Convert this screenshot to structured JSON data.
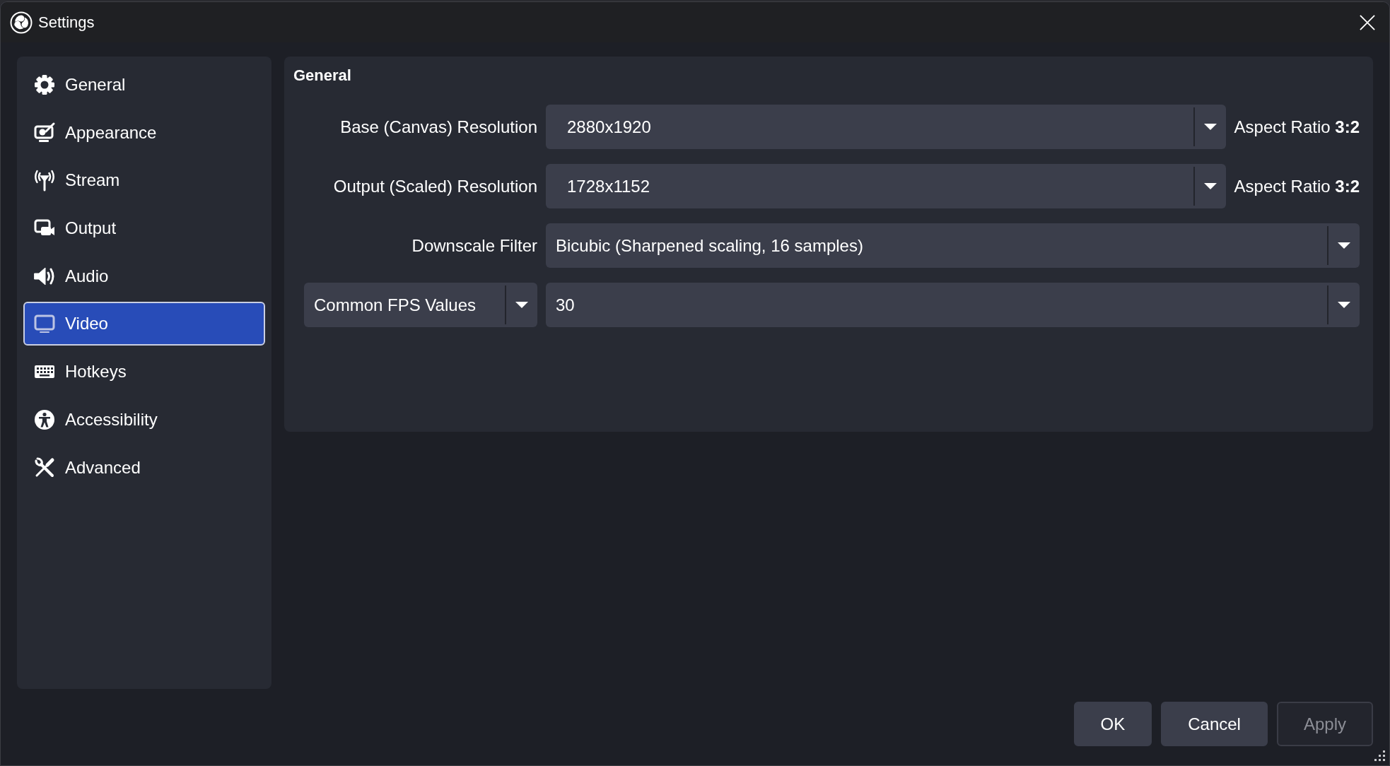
{
  "window": {
    "title": "Settings"
  },
  "sidebar": {
    "items": [
      {
        "label": "General",
        "selected": false
      },
      {
        "label": "Appearance",
        "selected": false
      },
      {
        "label": "Stream",
        "selected": false
      },
      {
        "label": "Output",
        "selected": false
      },
      {
        "label": "Audio",
        "selected": false
      },
      {
        "label": "Video",
        "selected": true
      },
      {
        "label": "Hotkeys",
        "selected": false
      },
      {
        "label": "Accessibility",
        "selected": false
      },
      {
        "label": "Advanced",
        "selected": false
      }
    ]
  },
  "form": {
    "title": "General",
    "rows": [
      {
        "kind": "resolution",
        "label": "Base (Canvas) Resolution",
        "value": "2880x1920",
        "editable": true,
        "note": "Aspect Ratio **3:2**"
      },
      {
        "kind": "resolution",
        "label": "Output (Scaled) Resolution",
        "value": "1728x1152",
        "editable": true,
        "note": "Aspect Ratio **3:2**"
      },
      {
        "kind": "select",
        "label": "Downscale Filter",
        "value": "Bicubic (Sharpened scaling, 16 samples)",
        "editable": false
      },
      {
        "kind": "fps",
        "mode": "Common FPS Values",
        "value": "30",
        "editable": false
      }
    ]
  },
  "buttons": [
    {
      "label": "OK",
      "disabled": false
    },
    {
      "label": "Cancel",
      "disabled": false
    },
    {
      "label": "Apply",
      "disabled": true
    }
  ]
}
